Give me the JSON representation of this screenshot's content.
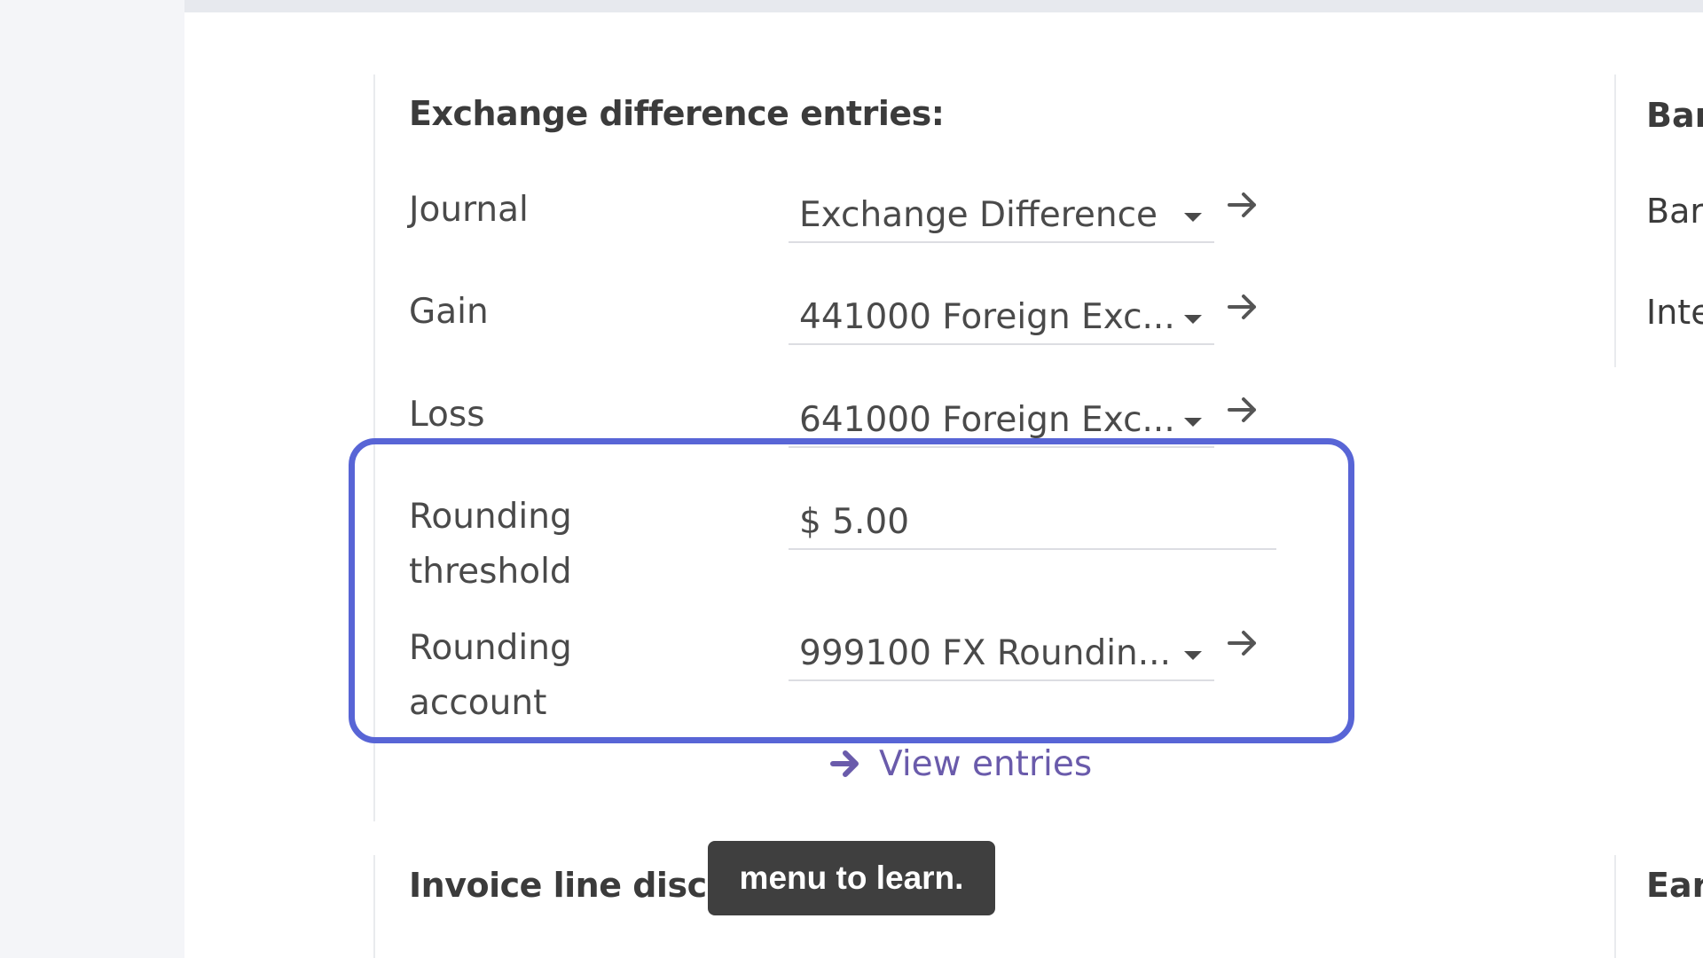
{
  "section": {
    "title": "Exchange difference entries:"
  },
  "fields": {
    "journal": {
      "label": "Journal",
      "value": "Exchange Difference"
    },
    "gain": {
      "label": "Gain",
      "value": "441000 Foreign Exc..."
    },
    "loss": {
      "label": "Loss",
      "value": "641000 Foreign Exc..."
    },
    "rounding_threshold": {
      "label_line1": "Rounding",
      "label_line2": "threshold",
      "value": "$ 5.00"
    },
    "rounding_account": {
      "label_line1": "Rounding",
      "label_line2": "account",
      "value": "999100 FX Roundin..."
    }
  },
  "actions": {
    "view_entries": "View entries"
  },
  "next_section": {
    "title_visible": "Invoice line discou"
  },
  "right_column": {
    "heading": "Bar",
    "row1": "Bar",
    "row2": "Inte",
    "lower_heading": "Ear"
  },
  "tooltip": {
    "text": "menu to learn."
  },
  "colors": {
    "highlight_border": "#5865d6",
    "link": "#6a5bab",
    "tooltip_bg": "#3f3f3f"
  },
  "icons": {
    "dropdown": "caret-down-icon",
    "external_link": "arrow-right-icon"
  }
}
